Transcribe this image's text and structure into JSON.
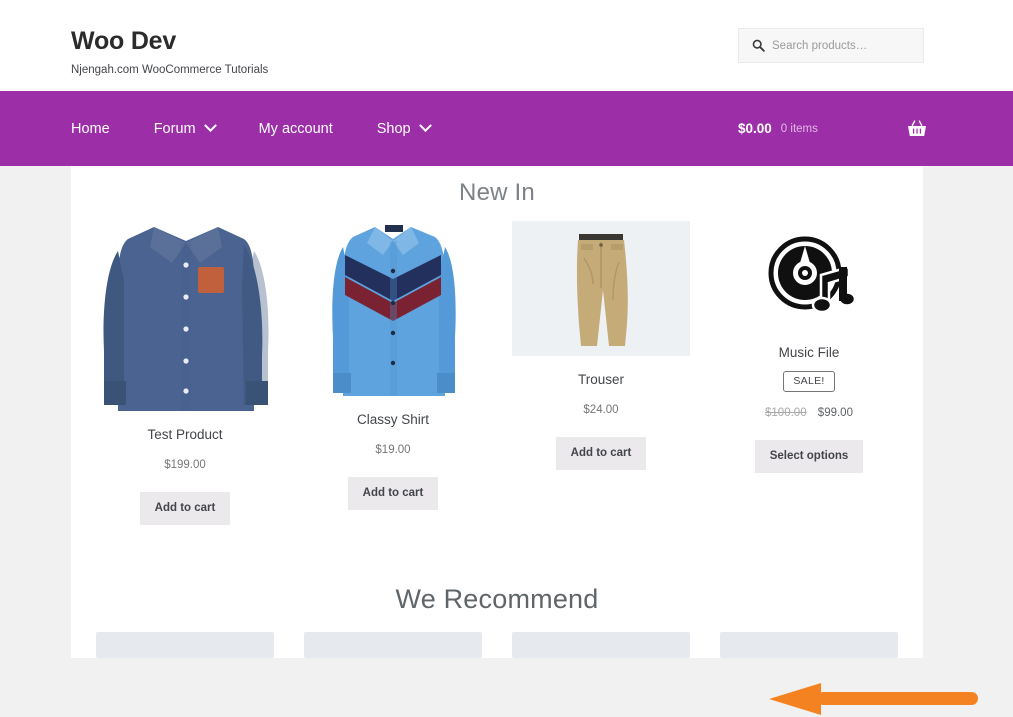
{
  "header": {
    "brand_title": "Woo Dev",
    "brand_tagline": "Njengah.com WooCommerce Tutorials",
    "search_placeholder": "Search products…",
    "search_value": "",
    "search_icon": "search-icon"
  },
  "nav": {
    "items": [
      {
        "label": "Home",
        "has_dropdown": false
      },
      {
        "label": "Forum",
        "has_dropdown": true
      },
      {
        "label": "My account",
        "has_dropdown": false
      },
      {
        "label": "Shop",
        "has_dropdown": true
      }
    ],
    "cart": {
      "amount": "$0.00",
      "count": "0 items",
      "icon": "shopping-basket-icon"
    },
    "background_color": "#9c2fa7"
  },
  "sections": {
    "new_in_heading": "New In",
    "recommend_heading": "We Recommend"
  },
  "products": [
    {
      "name": "Test Product",
      "price": "$199.00",
      "button_label": "Add to cart",
      "on_sale": false,
      "image": "blue-dress-shirt-photo"
    },
    {
      "name": "Classy Shirt",
      "price": "$19.00",
      "button_label": "Add to cart",
      "on_sale": false,
      "image": "light-blue-chevron-shirt-photo"
    },
    {
      "name": "Trouser",
      "price": "$24.00",
      "button_label": "Add to cart",
      "on_sale": false,
      "image": "khaki-trousers-photo"
    },
    {
      "name": "Music File",
      "sale_badge": "SALE!",
      "price_old": "$100.00",
      "price_new": "$99.00",
      "button_label": "Select options",
      "on_sale": true,
      "image": "vinyl-record-music-note-icon"
    }
  ],
  "annotation": {
    "type": "arrow",
    "direction": "left",
    "color": "#f58220"
  },
  "colors": {
    "page_background": "#f1f1f1",
    "content_background": "#ffffff",
    "nav_purple": "#9c2fa7",
    "button_gray": "#ebe9eb",
    "placeholder_gray": "#e6eaef",
    "arrow_orange": "#f58220"
  }
}
